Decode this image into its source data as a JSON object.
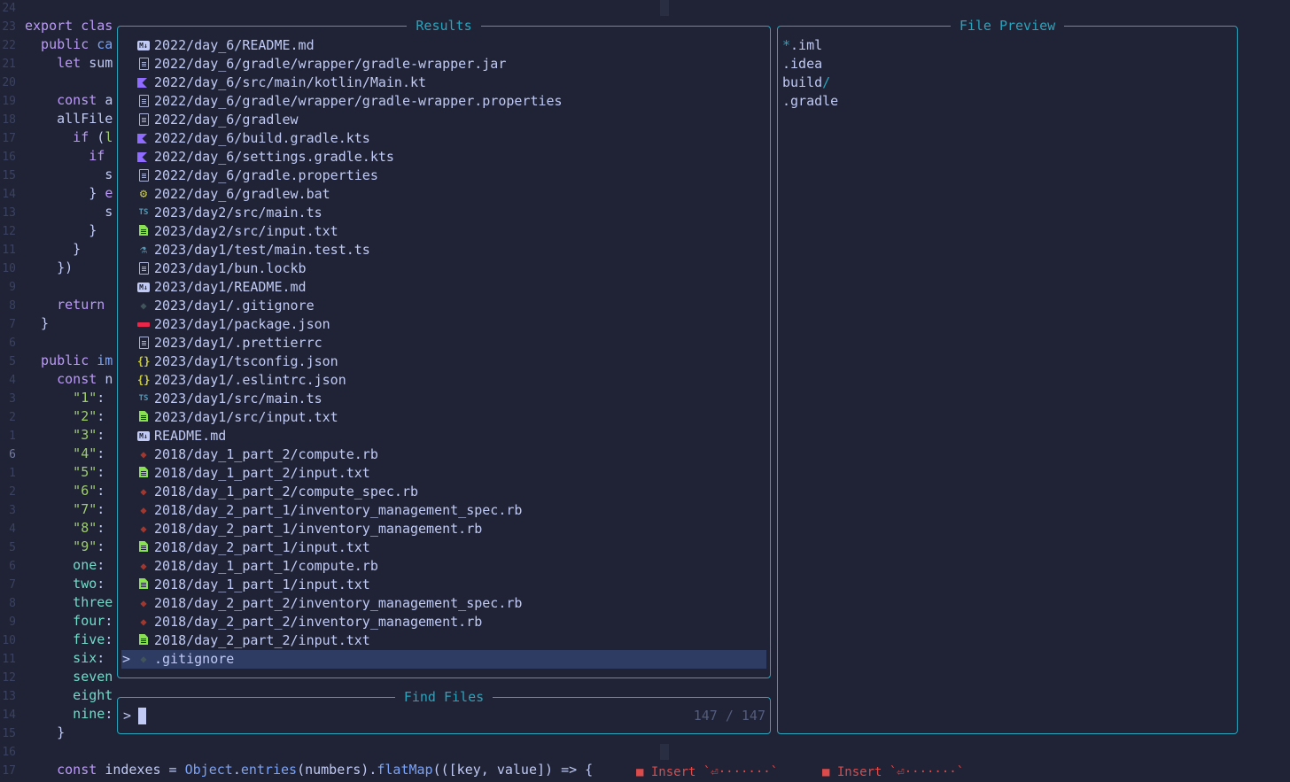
{
  "editor": {
    "lines": [
      {
        "n": "24",
        "parts": []
      },
      {
        "n": "23",
        "parts": [
          {
            "c": "kw",
            "t": "export "
          },
          {
            "c": "kw",
            "t": "clas"
          }
        ]
      },
      {
        "n": "22",
        "parts": [
          {
            "c": "kw",
            "t": "  public "
          },
          {
            "c": "fn",
            "t": "ca"
          }
        ]
      },
      {
        "n": "21",
        "parts": [
          {
            "c": "kw",
            "t": "    let "
          },
          {
            "c": "plain",
            "t": "sum"
          }
        ]
      },
      {
        "n": "20",
        "parts": []
      },
      {
        "n": "19",
        "parts": [
          {
            "c": "kw",
            "t": "    const "
          },
          {
            "c": "plain",
            "t": "a"
          }
        ]
      },
      {
        "n": "18",
        "parts": [
          {
            "c": "plain",
            "t": "    allFile"
          }
        ]
      },
      {
        "n": "17",
        "parts": [
          {
            "c": "kw",
            "t": "      if "
          },
          {
            "c": "plain",
            "t": "("
          },
          {
            "c": "str",
            "t": "l"
          }
        ]
      },
      {
        "n": "16",
        "parts": [
          {
            "c": "kw",
            "t": "        if"
          }
        ]
      },
      {
        "n": "15",
        "parts": [
          {
            "c": "plain",
            "t": "          s"
          }
        ]
      },
      {
        "n": "14",
        "parts": [
          {
            "c": "plain",
            "t": "        } "
          },
          {
            "c": "kw",
            "t": "e"
          }
        ]
      },
      {
        "n": "13",
        "parts": [
          {
            "c": "plain",
            "t": "          s"
          }
        ]
      },
      {
        "n": "12",
        "parts": [
          {
            "c": "plain",
            "t": "        }"
          }
        ]
      },
      {
        "n": "11",
        "parts": [
          {
            "c": "plain",
            "t": "      }"
          }
        ]
      },
      {
        "n": "10",
        "parts": [
          {
            "c": "plain",
            "t": "    })"
          }
        ]
      },
      {
        "n": "9",
        "parts": []
      },
      {
        "n": "8",
        "parts": [
          {
            "c": "kw",
            "t": "    return"
          }
        ]
      },
      {
        "n": "7",
        "parts": [
          {
            "c": "plain",
            "t": "  }"
          }
        ]
      },
      {
        "n": "6",
        "parts": []
      },
      {
        "n": "5",
        "parts": [
          {
            "c": "kw",
            "t": "  public "
          },
          {
            "c": "fn",
            "t": "im"
          }
        ]
      },
      {
        "n": "4",
        "parts": [
          {
            "c": "kw",
            "t": "    const "
          },
          {
            "c": "plain",
            "t": "n"
          }
        ]
      },
      {
        "n": "3",
        "parts": [
          {
            "c": "str",
            "t": "      \"1\""
          },
          {
            "c": "plain",
            "t": ":"
          }
        ]
      },
      {
        "n": "2",
        "parts": [
          {
            "c": "str",
            "t": "      \"2\""
          },
          {
            "c": "plain",
            "t": ":"
          }
        ]
      },
      {
        "n": "1",
        "parts": [
          {
            "c": "str",
            "t": "      \"3\""
          },
          {
            "c": "plain",
            "t": ":"
          }
        ]
      },
      {
        "n": "6",
        "cur": true,
        "parts": [
          {
            "c": "str",
            "t": "      \"4\""
          },
          {
            "c": "plain",
            "t": ":"
          }
        ]
      },
      {
        "n": "1",
        "parts": [
          {
            "c": "str",
            "t": "      \"5\""
          },
          {
            "c": "plain",
            "t": ":"
          }
        ]
      },
      {
        "n": "2",
        "parts": [
          {
            "c": "str",
            "t": "      \"6\""
          },
          {
            "c": "plain",
            "t": ":"
          }
        ]
      },
      {
        "n": "3",
        "parts": [
          {
            "c": "str",
            "t": "      \"7\""
          },
          {
            "c": "plain",
            "t": ":"
          }
        ]
      },
      {
        "n": "4",
        "parts": [
          {
            "c": "str",
            "t": "      \"8\""
          },
          {
            "c": "plain",
            "t": ":"
          }
        ]
      },
      {
        "n": "5",
        "parts": [
          {
            "c": "str",
            "t": "      \"9\""
          },
          {
            "c": "plain",
            "t": ":"
          }
        ]
      },
      {
        "n": "6",
        "parts": [
          {
            "c": "prop",
            "t": "      one"
          },
          {
            "c": "plain",
            "t": ":"
          }
        ]
      },
      {
        "n": "7",
        "parts": [
          {
            "c": "prop",
            "t": "      two"
          },
          {
            "c": "plain",
            "t": ":"
          }
        ]
      },
      {
        "n": "8",
        "parts": [
          {
            "c": "prop",
            "t": "      three"
          }
        ]
      },
      {
        "n": "9",
        "parts": [
          {
            "c": "prop",
            "t": "      four"
          },
          {
            "c": "plain",
            "t": ":"
          }
        ]
      },
      {
        "n": "10",
        "parts": [
          {
            "c": "prop",
            "t": "      five"
          },
          {
            "c": "plain",
            "t": ":"
          }
        ]
      },
      {
        "n": "11",
        "parts": [
          {
            "c": "prop",
            "t": "      six"
          },
          {
            "c": "plain",
            "t": ":"
          }
        ]
      },
      {
        "n": "12",
        "parts": [
          {
            "c": "prop",
            "t": "      seven"
          }
        ]
      },
      {
        "n": "13",
        "parts": [
          {
            "c": "prop",
            "t": "      eight"
          }
        ]
      },
      {
        "n": "14",
        "parts": [
          {
            "c": "prop",
            "t": "      nine"
          },
          {
            "c": "plain",
            "t": ":"
          }
        ]
      },
      {
        "n": "15",
        "parts": [
          {
            "c": "plain",
            "t": "    }"
          }
        ]
      },
      {
        "n": "16",
        "parts": []
      },
      {
        "n": "17",
        "parts": [
          {
            "c": "kw",
            "t": "    const "
          },
          {
            "c": "plain",
            "t": "indexes = "
          },
          {
            "c": "fn",
            "t": "Object"
          },
          {
            "c": "plain",
            "t": "."
          },
          {
            "c": "fn",
            "t": "entries"
          },
          {
            "c": "plain",
            "t": "(numbers)."
          },
          {
            "c": "fn",
            "t": "flatMap"
          },
          {
            "c": "plain",
            "t": "(([key, value]) => {"
          }
        ]
      }
    ],
    "virtual_text": [
      "■ Insert `⏎·······`",
      "■ Insert `⏎·······`"
    ]
  },
  "results": {
    "title": "Results",
    "items": [
      {
        "icon": "md",
        "path": "2022/day_6/README.md"
      },
      {
        "icon": "doc",
        "path": "2022/day_6/gradle/wrapper/gradle-wrapper.jar"
      },
      {
        "icon": "kotlin",
        "path": "2022/day_6/src/main/kotlin/Main.kt"
      },
      {
        "icon": "doc",
        "path": "2022/day_6/gradle/wrapper/gradle-wrapper.properties"
      },
      {
        "icon": "doc",
        "path": "2022/day_6/gradlew"
      },
      {
        "icon": "kotlin",
        "path": "2022/day_6/build.gradle.kts"
      },
      {
        "icon": "kotlin",
        "path": "2022/day_6/settings.gradle.kts"
      },
      {
        "icon": "doc",
        "path": "2022/day_6/gradle.properties"
      },
      {
        "icon": "gear",
        "path": "2022/day_6/gradlew.bat"
      },
      {
        "icon": "ts",
        "path": "2023/day2/src/main.ts"
      },
      {
        "icon": "txt",
        "path": "2023/day2/src/input.txt"
      },
      {
        "icon": "test",
        "path": "2023/day1/test/main.test.ts"
      },
      {
        "icon": "doc",
        "path": "2023/day1/bun.lockb"
      },
      {
        "icon": "md",
        "path": "2023/day1/README.md"
      },
      {
        "icon": "git",
        "path": "2023/day1/.gitignore"
      },
      {
        "icon": "npm",
        "path": "2023/day1/package.json"
      },
      {
        "icon": "doc",
        "path": "2023/day1/.prettierrc"
      },
      {
        "icon": "json",
        "path": "2023/day1/tsconfig.json"
      },
      {
        "icon": "json",
        "path": "2023/day1/.eslintrc.json"
      },
      {
        "icon": "ts",
        "path": "2023/day1/src/main.ts"
      },
      {
        "icon": "txt",
        "path": "2023/day1/src/input.txt"
      },
      {
        "icon": "md",
        "path": "README.md"
      },
      {
        "icon": "ruby",
        "path": "2018/day_1_part_2/compute.rb"
      },
      {
        "icon": "txt",
        "path": "2018/day_1_part_2/input.txt"
      },
      {
        "icon": "ruby",
        "path": "2018/day_1_part_2/compute_spec.rb"
      },
      {
        "icon": "ruby",
        "path": "2018/day_2_part_1/inventory_management_spec.rb"
      },
      {
        "icon": "ruby",
        "path": "2018/day_2_part_1/inventory_management.rb"
      },
      {
        "icon": "txt",
        "path": "2018/day_2_part_1/input.txt"
      },
      {
        "icon": "ruby",
        "path": "2018/day_1_part_1/compute.rb"
      },
      {
        "icon": "txt",
        "path": "2018/day_1_part_1/input.txt"
      },
      {
        "icon": "ruby",
        "path": "2018/day_2_part_2/inventory_management_spec.rb"
      },
      {
        "icon": "ruby",
        "path": "2018/day_2_part_2/inventory_management.rb"
      },
      {
        "icon": "txt",
        "path": "2018/day_2_part_2/input.txt"
      },
      {
        "icon": "git",
        "path": ".gitignore",
        "selected": true
      }
    ],
    "selection_caret": ">"
  },
  "prompt": {
    "title": "Find Files",
    "caret": ">",
    "value": "",
    "counter": "147 / 147"
  },
  "preview": {
    "title": "File Preview",
    "lines": [
      [
        {
          "c": "accent",
          "t": "*"
        },
        {
          "c": "plain",
          "t": ".iml"
        }
      ],
      [
        {
          "c": "plain",
          "t": ".idea"
        }
      ],
      [
        {
          "c": "plain",
          "t": "build"
        },
        {
          "c": "accent",
          "t": "/"
        }
      ],
      [
        {
          "c": "plain",
          "t": ".gradle"
        }
      ]
    ]
  },
  "colors": {
    "background": "#1f2335",
    "border_accent": "#29a4bd",
    "selection": "#2e3c64",
    "keyword": "#bb9af7",
    "string": "#9ece6a",
    "error": "#db4b4b"
  }
}
